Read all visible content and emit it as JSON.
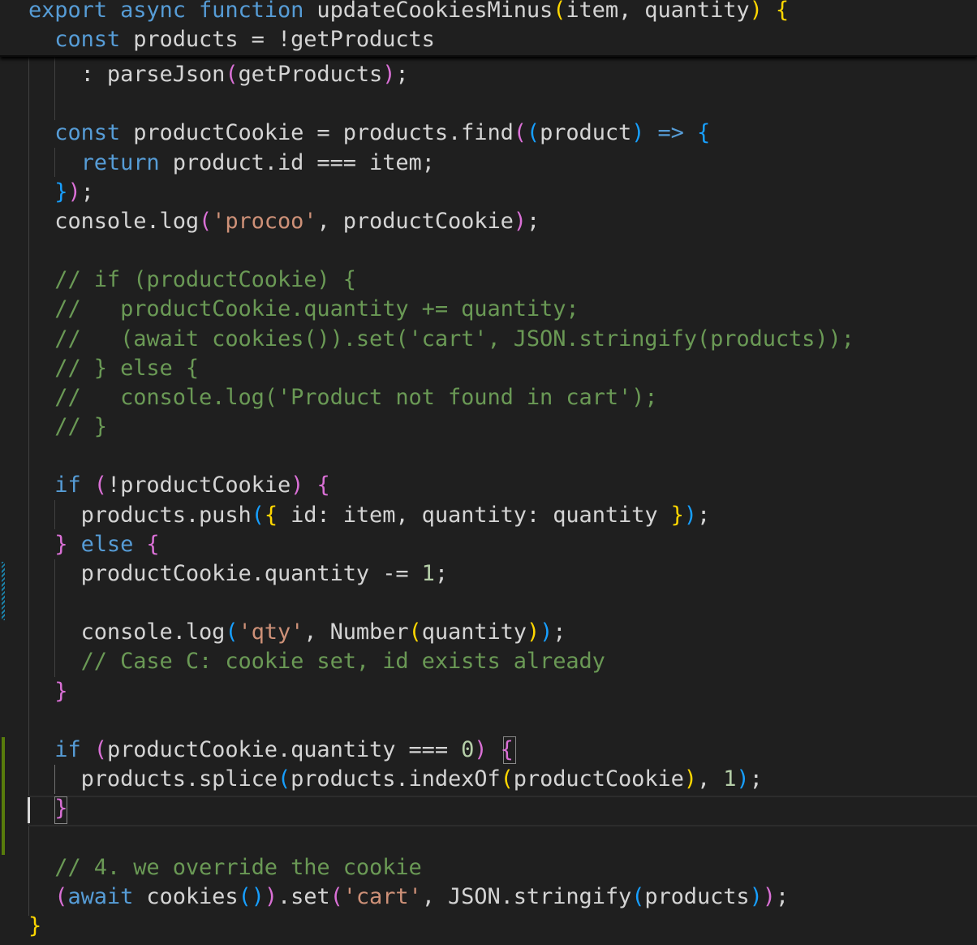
{
  "colors": {
    "keyword": "#569cd6",
    "text": "#d4d4d4",
    "string": "#ce9178",
    "comment": "#6a9955",
    "number": "#b5cea8",
    "bracket1": "#ffd700",
    "bracket2": "#da70d6",
    "bracket3": "#179fff",
    "git_added": "#587c0c",
    "git_modified": "#1b81a8"
  },
  "sticky": [
    [
      [
        "export async function",
        "k"
      ],
      [
        " updateCookiesMinus",
        "t"
      ],
      [
        "(",
        "b1"
      ],
      [
        "item, quantity",
        "t"
      ],
      [
        ")",
        "b1"
      ],
      [
        " ",
        "t"
      ],
      [
        "{",
        "b1"
      ]
    ],
    [
      [
        "  const",
        "k"
      ],
      [
        " products = !getProducts",
        "t"
      ]
    ]
  ],
  "lines": [
    [
      [
        "    : parseJson",
        "t"
      ],
      [
        "(",
        "b2"
      ],
      [
        "getProducts",
        "t"
      ],
      [
        ")",
        "b2"
      ],
      [
        ";",
        "t"
      ]
    ],
    [],
    [
      [
        "  const",
        "k"
      ],
      [
        " productCookie = products.find",
        "t"
      ],
      [
        "(",
        "b2"
      ],
      [
        "(",
        "b3"
      ],
      [
        "product",
        "t"
      ],
      [
        ")",
        "b3"
      ],
      [
        " =>",
        "k"
      ],
      [
        " ",
        "t"
      ],
      [
        "{",
        "b3"
      ]
    ],
    [
      [
        "    return",
        "k"
      ],
      [
        " product.id === item;",
        "t"
      ]
    ],
    [
      [
        "  }",
        "b3"
      ],
      [
        ")",
        "b2"
      ],
      [
        ";",
        "t"
      ]
    ],
    [
      [
        "  console.log",
        "t"
      ],
      [
        "(",
        "b2"
      ],
      [
        "'procoo'",
        "s"
      ],
      [
        ", productCookie",
        "t"
      ],
      [
        ")",
        "b2"
      ],
      [
        ";",
        "t"
      ]
    ],
    [],
    [
      [
        "  // if (productCookie) {",
        "c"
      ]
    ],
    [
      [
        "  //   productCookie.quantity += quantity;",
        "c"
      ]
    ],
    [
      [
        "  //   (await cookies()).set('cart', JSON.stringify(products));",
        "c"
      ]
    ],
    [
      [
        "  // } else {",
        "c"
      ]
    ],
    [
      [
        "  //   console.log('Product not found in cart');",
        "c"
      ]
    ],
    [
      [
        "  // }",
        "c"
      ]
    ],
    [],
    [
      [
        "  if",
        "k"
      ],
      [
        " ",
        "t"
      ],
      [
        "(",
        "b2"
      ],
      [
        "!productCookie",
        "t"
      ],
      [
        ")",
        "b2"
      ],
      [
        " ",
        "t"
      ],
      [
        "{",
        "b2"
      ]
    ],
    [
      [
        "    products.push",
        "t"
      ],
      [
        "(",
        "b3"
      ],
      [
        "{",
        "b1"
      ],
      [
        " id: item, quantity: quantity ",
        "t"
      ],
      [
        "}",
        "b1"
      ],
      [
        ")",
        "b3"
      ],
      [
        ";",
        "t"
      ]
    ],
    [
      [
        "  }",
        "b2"
      ],
      [
        " else",
        "k"
      ],
      [
        " ",
        "t"
      ],
      [
        "{",
        "b2"
      ]
    ],
    [
      [
        "    productCookie.quantity -= ",
        "t"
      ],
      [
        "1",
        "n"
      ],
      [
        ";",
        "t"
      ]
    ],
    [],
    [
      [
        "    console.log",
        "t"
      ],
      [
        "(",
        "b3"
      ],
      [
        "'qty'",
        "s"
      ],
      [
        ", Number",
        "t"
      ],
      [
        "(",
        "b1"
      ],
      [
        "quantity",
        "t"
      ],
      [
        ")",
        "b1"
      ],
      [
        ")",
        "b3"
      ],
      [
        ";",
        "t"
      ]
    ],
    [
      [
        "    // Case C: cookie set, id exists already",
        "c"
      ]
    ],
    [
      [
        "  }",
        "b2"
      ]
    ],
    [],
    [
      [
        "  if",
        "k"
      ],
      [
        " ",
        "t"
      ],
      [
        "(",
        "b2"
      ],
      [
        "productCookie.quantity === ",
        "t"
      ],
      [
        "0",
        "n"
      ],
      [
        ")",
        "b2"
      ],
      [
        " ",
        "t"
      ],
      [
        "{",
        "b2"
      ]
    ],
    [
      [
        "    products.splice",
        "t"
      ],
      [
        "(",
        "b3"
      ],
      [
        "products.indexOf",
        "t"
      ],
      [
        "(",
        "b1"
      ],
      [
        "productCookie",
        "t"
      ],
      [
        ")",
        "b1"
      ],
      [
        ", ",
        "t"
      ],
      [
        "1",
        "n"
      ],
      [
        ")",
        "b3"
      ],
      [
        ";",
        "t"
      ]
    ],
    [
      [
        "  }",
        "b2"
      ]
    ],
    [],
    [
      [
        "  // 4. we override the cookie",
        "c"
      ]
    ],
    [
      [
        "  (",
        "b2"
      ],
      [
        "await",
        "k"
      ],
      [
        " cookies",
        "t"
      ],
      [
        "(",
        "b3"
      ],
      [
        ")",
        "b3"
      ],
      [
        ")",
        "b2"
      ],
      [
        ".set",
        "t"
      ],
      [
        "(",
        "b2"
      ],
      [
        "'cart'",
        "s"
      ],
      [
        ", JSON.stringify",
        "t"
      ],
      [
        "(",
        "b3"
      ],
      [
        "products",
        "t"
      ],
      [
        ")",
        "b3"
      ],
      [
        ")",
        "b2"
      ],
      [
        ";",
        "t"
      ]
    ],
    [
      [
        "}",
        "b1"
      ]
    ]
  ]
}
